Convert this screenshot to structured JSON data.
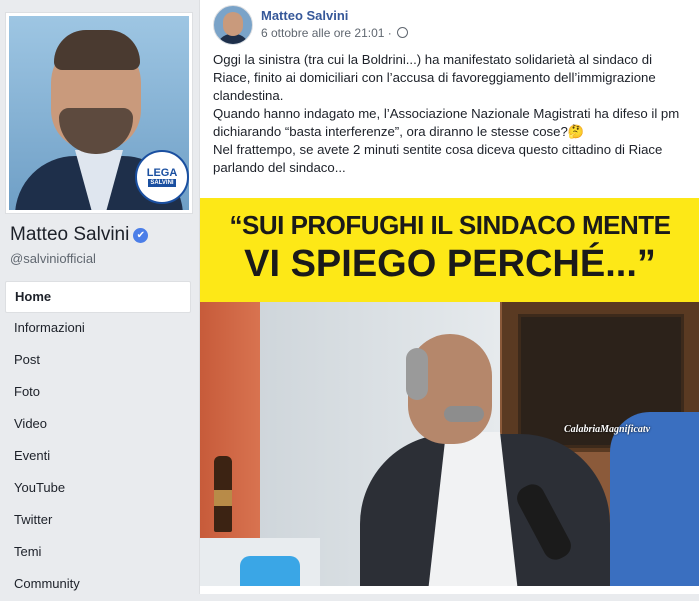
{
  "sidebar": {
    "page_name": "Matteo Salvini",
    "verified_mark": "✔",
    "username": "@salviniofficial",
    "badge_line1": "LEGA",
    "badge_line2": "SALVINI",
    "nav": [
      {
        "label": "Home",
        "active": true
      },
      {
        "label": "Informazioni"
      },
      {
        "label": "Post"
      },
      {
        "label": "Foto"
      },
      {
        "label": "Video"
      },
      {
        "label": "Eventi"
      },
      {
        "label": "YouTube"
      },
      {
        "label": "Twitter"
      },
      {
        "label": "Temi"
      },
      {
        "label": "Community"
      }
    ]
  },
  "post": {
    "author": "Matteo Salvini",
    "timestamp": "6 ottobre alle ore 21:01 ·",
    "privacy_icon": "globe-icon",
    "paragraphs": [
      "Oggi la sinistra (tra cui la Boldrini...) ha manifestato solidarietà al sindaco di Riace, finito ai domiciliari con l’accusa di favoreggiamento dell’immigrazione clandestina.",
      "Quando hanno indagato me, l’Associazione Nazionale Magistrati ha difeso il pm dichiarando “basta interferenze”, ora diranno le stesse cose?🤔",
      "Nel frattempo, se avete 2 minuti sentite cosa diceva questo cittadino di Riace parlando del sindaco..."
    ],
    "video": {
      "banner_line1": "“SUI PROFUGHI IL SINDACO MENTE",
      "banner_line2": "VI SPIEGO PERCHÉ...”",
      "watermark": "CalabriaMagnificatv"
    }
  },
  "colors": {
    "facebook_link": "#365899",
    "banner_yellow": "#fde817",
    "background": "#e9ebee"
  }
}
